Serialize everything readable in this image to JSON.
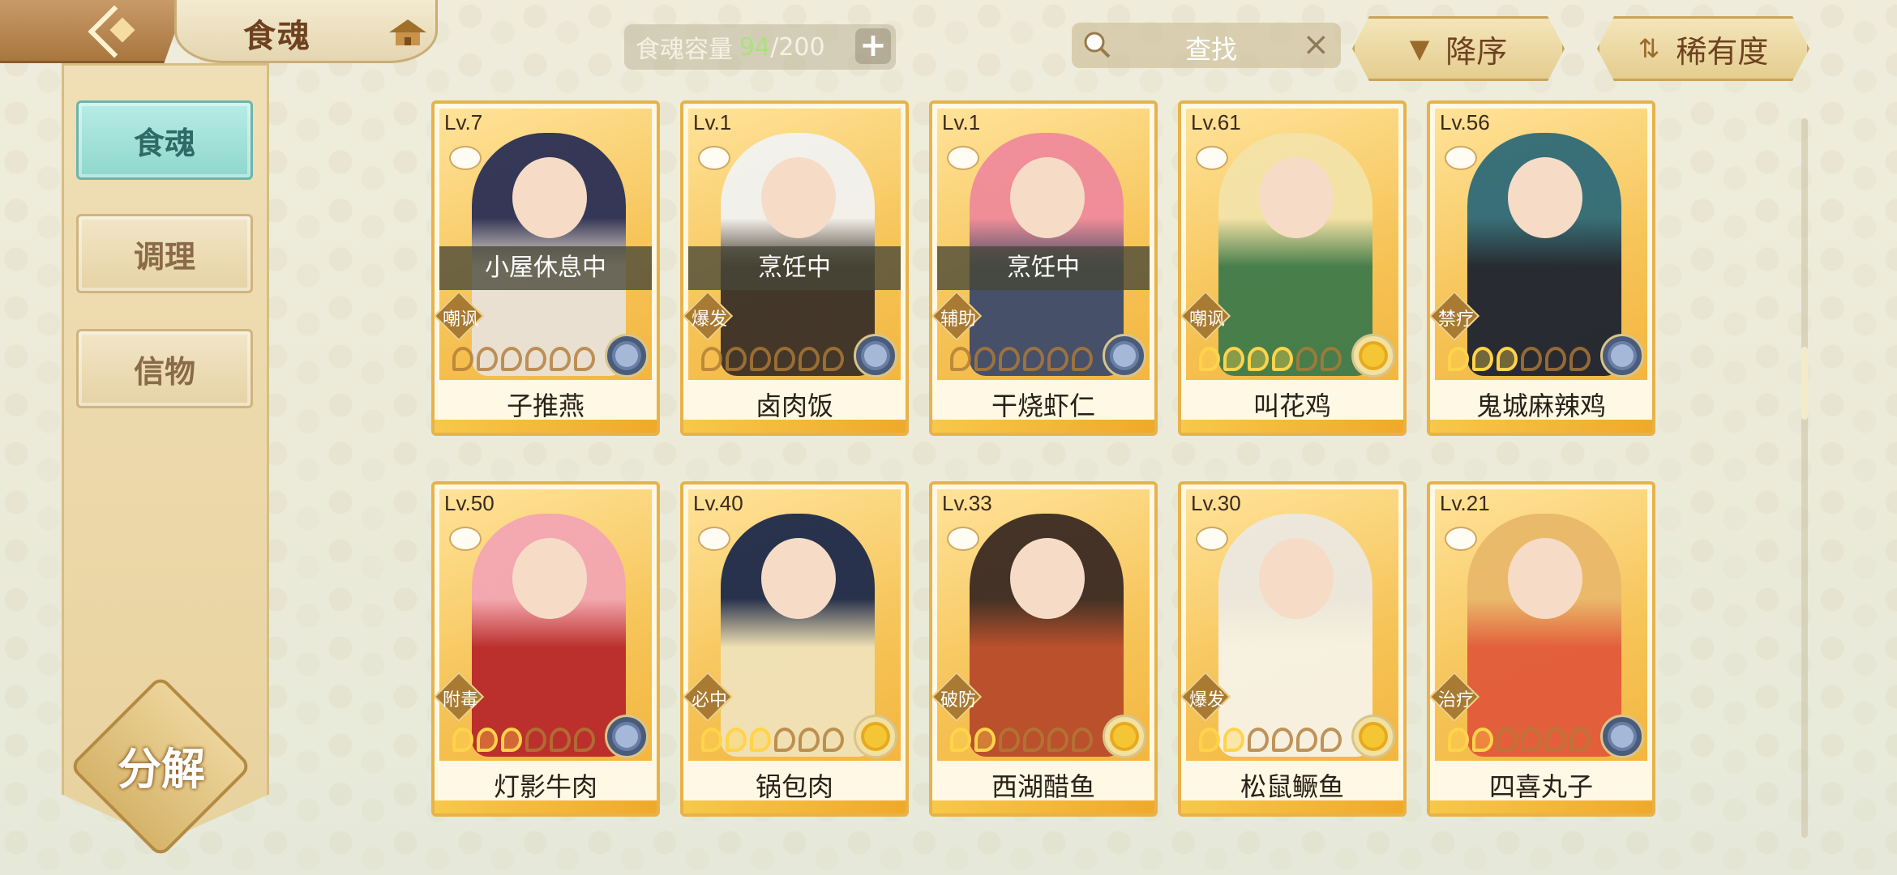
{
  "header": {
    "title": "食魂",
    "capacity_label": "食魂容量",
    "capacity_current": "94",
    "capacity_max": "/200",
    "search_placeholder": "查找",
    "sort_desc_label": "降序",
    "sort_rarity_label": "稀有度"
  },
  "sidebar": {
    "items": [
      {
        "label": "食魂"
      },
      {
        "label": "调理"
      },
      {
        "label": "信物"
      }
    ],
    "decompose_label": "分解"
  },
  "cards": [
    {
      "level": "Lv.7",
      "name": "子推燕",
      "status": "小屋休息中",
      "tag": "嘲讽",
      "stars": 0,
      "badge": "blue"
    },
    {
      "level": "Lv.1",
      "name": "卤肉饭",
      "status": "烹饪中",
      "tag": "爆发",
      "stars": 0,
      "badge": "blue"
    },
    {
      "level": "Lv.1",
      "name": "干烧虾仁",
      "status": "烹饪中",
      "tag": "辅助",
      "stars": 0,
      "badge": "blue"
    },
    {
      "level": "Lv.61",
      "name": "叫花鸡",
      "status": "",
      "tag": "嘲讽",
      "stars": 4,
      "badge": "gold"
    },
    {
      "level": "Lv.56",
      "name": "鬼城麻辣鸡",
      "status": "",
      "tag": "禁疗",
      "stars": 3,
      "badge": "blue"
    },
    {
      "level": "Lv.50",
      "name": "灯影牛肉",
      "status": "",
      "tag": "附毒",
      "stars": 3,
      "badge": "blue"
    },
    {
      "level": "Lv.40",
      "name": "锅包肉",
      "status": "",
      "tag": "必中",
      "stars": 3,
      "badge": "gold"
    },
    {
      "level": "Lv.33",
      "name": "西湖醋鱼",
      "status": "",
      "tag": "破防",
      "stars": 2,
      "badge": "gold"
    },
    {
      "level": "Lv.30",
      "name": "松鼠鳜鱼",
      "status": "",
      "tag": "爆发",
      "stars": 2,
      "badge": "gold"
    },
    {
      "level": "Lv.21",
      "name": "四喜丸子",
      "status": "",
      "tag": "治疗",
      "stars": 2,
      "badge": "blue"
    }
  ],
  "colors": {
    "accent_teal": "#8ed7cc",
    "card_border": "#e8b24a",
    "capacity_green": "#a8e37a"
  },
  "icons": [
    "back-arrow-icon",
    "home-icon",
    "search-icon",
    "close-icon",
    "sort-down-icon",
    "sort-swap-icon",
    "bowl-icon",
    "flower-badge-icon"
  ]
}
